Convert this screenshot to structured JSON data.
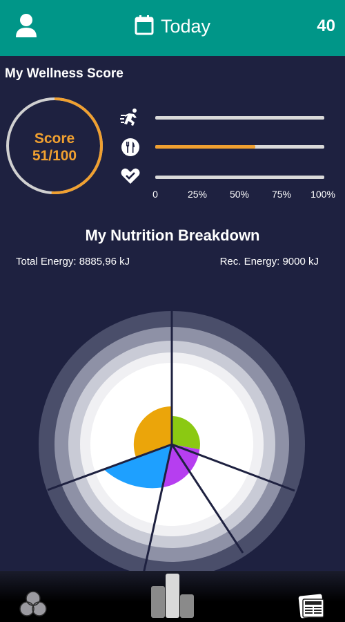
{
  "header": {
    "title": "Today",
    "count": "40",
    "icons": [
      "user-icon",
      "calendar-icon"
    ]
  },
  "wellness": {
    "title": "My Wellness Score",
    "score_label": "Score",
    "score_value": "51/100",
    "score_fraction": 0.51,
    "metrics": [
      {
        "name": "activity",
        "icon": "running-icon",
        "progress": 0
      },
      {
        "name": "nutrition",
        "icon": "fork-knife-icon",
        "progress": 0.59
      },
      {
        "name": "health",
        "icon": "heart-check-icon",
        "progress": 0
      }
    ],
    "axis_ticks": [
      "0",
      "25%",
      "50%",
      "75%",
      "100%"
    ],
    "colors": {
      "accent": "#f0a030",
      "track": "#d9d9d9"
    }
  },
  "nutrition": {
    "title": "My Nutrition Breakdown",
    "total_energy": "Total Energy: 8885,96 kJ",
    "rec_energy": "Rec. Energy: 9000 kJ",
    "colors": [
      "#8bc912",
      "#b63ef0",
      "#1ea0ff",
      "#eba50a"
    ]
  },
  "bottom_nav": {
    "items": [
      "circles-icon",
      "bar-chart-icon",
      "news-icon"
    ]
  },
  "colors": {
    "header": "#009688",
    "background": "#1e2140"
  }
}
